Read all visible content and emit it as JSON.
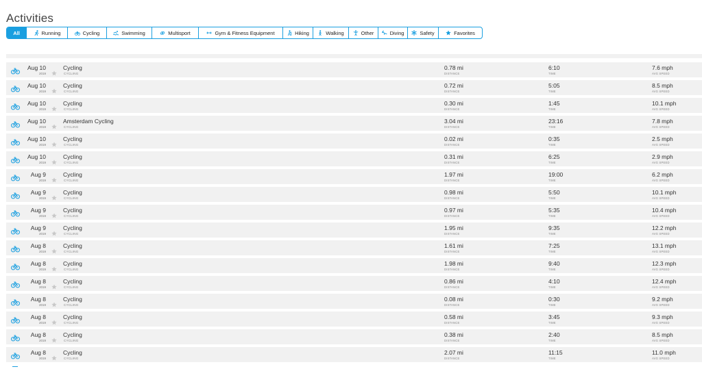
{
  "page": {
    "title": "Activities"
  },
  "colors": {
    "accent": "#1a9fe0",
    "row_bg": "#f1f1f1",
    "star": "#c8c8c8"
  },
  "filters": [
    {
      "label": "All",
      "icon": "none",
      "active": true
    },
    {
      "label": "Running",
      "icon": "running-icon"
    },
    {
      "label": "Cycling",
      "icon": "cycling-icon"
    },
    {
      "label": "Swimming",
      "icon": "swimming-icon"
    },
    {
      "label": "Multisport",
      "icon": "multisport-icon"
    },
    {
      "label": "Gym & Fitness Equipment",
      "icon": "gym-icon"
    },
    {
      "label": "Hiking",
      "icon": "hiking-icon"
    },
    {
      "label": "Walking",
      "icon": "walking-icon"
    },
    {
      "label": "Other",
      "icon": "other-icon"
    },
    {
      "label": "Diving",
      "icon": "diving-icon"
    },
    {
      "label": "Safety",
      "icon": "safety-icon"
    },
    {
      "label": "Favorites",
      "icon": "star-icon"
    }
  ],
  "column_labels": {
    "distance": "DISTANCE",
    "time": "TIME",
    "speed": "AVG SPEED"
  },
  "activities": [
    {
      "date": "Aug 10",
      "year": "2019",
      "name": "Cycling",
      "type": "CYCLING",
      "distance": "0.78 mi",
      "time": "6:10",
      "speed": "7.6 mph"
    },
    {
      "date": "Aug 10",
      "year": "2019",
      "name": "Cycling",
      "type": "CYCLING",
      "distance": "0.72 mi",
      "time": "5:05",
      "speed": "8.5 mph"
    },
    {
      "date": "Aug 10",
      "year": "2019",
      "name": "Cycling",
      "type": "CYCLING",
      "distance": "0.30 mi",
      "time": "1:45",
      "speed": "10.1 mph"
    },
    {
      "date": "Aug 10",
      "year": "2019",
      "name": "Amsterdam Cycling",
      "type": "CYCLING",
      "distance": "3.04 mi",
      "time": "23:16",
      "speed": "7.8 mph"
    },
    {
      "date": "Aug 10",
      "year": "2019",
      "name": "Cycling",
      "type": "CYCLING",
      "distance": "0.02 mi",
      "time": "0:35",
      "speed": "2.5 mph"
    },
    {
      "date": "Aug 10",
      "year": "2019",
      "name": "Cycling",
      "type": "CYCLING",
      "distance": "0.31 mi",
      "time": "6:25",
      "speed": "2.9 mph"
    },
    {
      "date": "Aug 9",
      "year": "2019",
      "name": "Cycling",
      "type": "CYCLING",
      "distance": "1.97 mi",
      "time": "19:00",
      "speed": "6.2 mph"
    },
    {
      "date": "Aug 9",
      "year": "2019",
      "name": "Cycling",
      "type": "CYCLING",
      "distance": "0.98 mi",
      "time": "5:50",
      "speed": "10.1 mph"
    },
    {
      "date": "Aug 9",
      "year": "2019",
      "name": "Cycling",
      "type": "CYCLING",
      "distance": "0.97 mi",
      "time": "5:35",
      "speed": "10.4 mph"
    },
    {
      "date": "Aug 9",
      "year": "2019",
      "name": "Cycling",
      "type": "CYCLING",
      "distance": "1.95 mi",
      "time": "9:35",
      "speed": "12.2 mph"
    },
    {
      "date": "Aug 8",
      "year": "2019",
      "name": "Cycling",
      "type": "CYCLING",
      "distance": "1.61 mi",
      "time": "7:25",
      "speed": "13.1 mph"
    },
    {
      "date": "Aug 8",
      "year": "2019",
      "name": "Cycling",
      "type": "CYCLING",
      "distance": "1.98 mi",
      "time": "9:40",
      "speed": "12.3 mph"
    },
    {
      "date": "Aug 8",
      "year": "2019",
      "name": "Cycling",
      "type": "CYCLING",
      "distance": "0.86 mi",
      "time": "4:10",
      "speed": "12.4 mph"
    },
    {
      "date": "Aug 8",
      "year": "2019",
      "name": "Cycling",
      "type": "CYCLING",
      "distance": "0.08 mi",
      "time": "0:30",
      "speed": "9.2 mph"
    },
    {
      "date": "Aug 8",
      "year": "2019",
      "name": "Cycling",
      "type": "CYCLING",
      "distance": "0.58 mi",
      "time": "3:45",
      "speed": "9.3 mph"
    },
    {
      "date": "Aug 8",
      "year": "2019",
      "name": "Cycling",
      "type": "CYCLING",
      "distance": "0.38 mi",
      "time": "2:40",
      "speed": "8.5 mph"
    },
    {
      "date": "Aug 8",
      "year": "2019",
      "name": "Cycling",
      "type": "CYCLING",
      "distance": "2.07 mi",
      "time": "11:15",
      "speed": "11.0 mph"
    }
  ]
}
